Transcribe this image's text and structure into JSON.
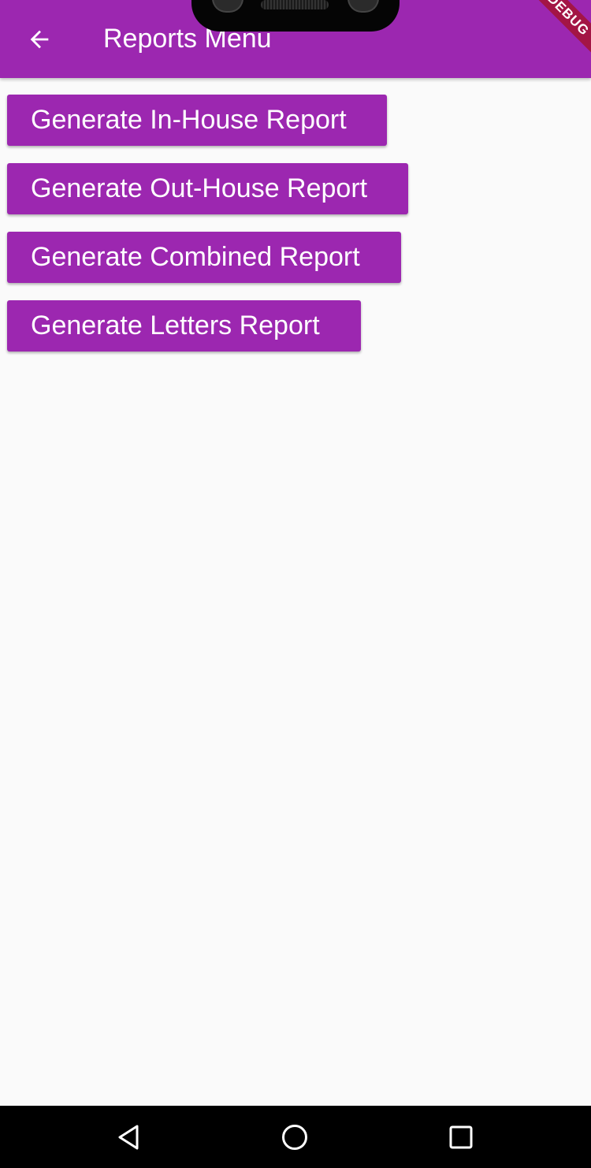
{
  "app_bar": {
    "title": "Reports Menu",
    "back_icon": "arrow-back-icon",
    "background_color": "#9c27b0",
    "debug_banner": "DEBUG"
  },
  "buttons": [
    {
      "label": "Generate In-House Report"
    },
    {
      "label": "Generate Out-House Report"
    },
    {
      "label": "Generate Combined Report"
    },
    {
      "label": "Generate Letters Report"
    }
  ],
  "button_color": "#9c27b0",
  "nav_bar": {
    "back_icon": "nav-back-triangle-icon",
    "home_icon": "nav-home-circle-icon",
    "recents_icon": "nav-recents-square-icon"
  }
}
